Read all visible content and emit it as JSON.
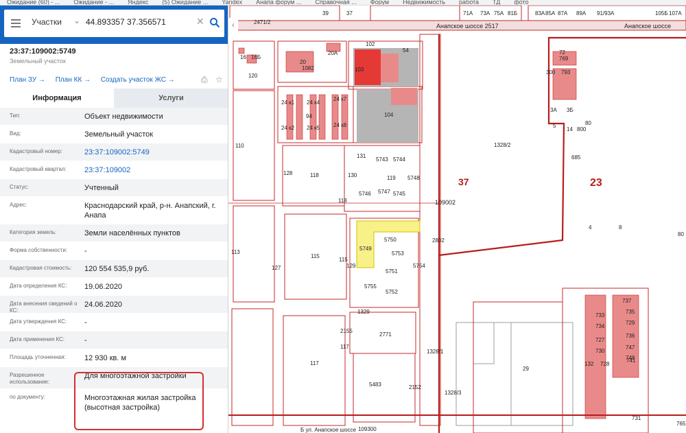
{
  "bookmarks": [
    "Ожидание (60) - ...",
    "Ожидание - ...",
    "Яндекс",
    "(5) Ожидание ...",
    "Yandex",
    "Анапа форум ...",
    "Справочная ...",
    "Форум",
    "Недвижимость",
    "работа",
    "ТД",
    "фото"
  ],
  "search": {
    "mode": "Участки",
    "query": "44.893357 37.356571"
  },
  "parcel": {
    "number": "23:37:109002:5749",
    "type": "Земельный участок"
  },
  "links": [
    "План ЗУ →",
    "План КК →",
    "Создать участок ЖС →"
  ],
  "tabs": [
    "Информация",
    "Услуги"
  ],
  "info": [
    {
      "key": "Тип:",
      "value": "Объект недвижимости"
    },
    {
      "key": "Вид:",
      "value": "Земельный участок"
    },
    {
      "key": "Кадастровый номер:",
      "value": "23:37:109002:5749"
    },
    {
      "key": "Кадастровый квартал:",
      "value": "23:37:109002"
    },
    {
      "key": "Статус:",
      "value": "Учтенный"
    },
    {
      "key": "Адрес:",
      "value": "Краснодарский край, р-н. Анапский, г. Анапа"
    },
    {
      "key": "Категория земель:",
      "value": "Земли населённых пунктов"
    },
    {
      "key": "Форма собственности:",
      "value": "-"
    },
    {
      "key": "Кадастровая стоимость:",
      "value": "120 554 535,9 руб."
    },
    {
      "key": "Дата определения КС:",
      "value": "19.06.2020"
    },
    {
      "key": "Дата внесения сведений о КС:",
      "value": "24.06.2020"
    },
    {
      "key": "Дата утверждения КС:",
      "value": "-"
    },
    {
      "key": "Дата применения КС:",
      "value": "-"
    },
    {
      "key": "Площадь уточненная:",
      "value": "12 930 кв. м"
    },
    {
      "key": "Разрешенное использование:",
      "value": "Для многоэтажной застройки"
    },
    {
      "key": "по документу:",
      "value": "Многоэтажная жилая застройка (высотная застройка)"
    }
  ],
  "map": {
    "road_label_1": "Анапское шоссе 2517",
    "road_label_2": "Анапское шоссе",
    "district_37": "37",
    "district_23": "23",
    "quarter": "109002",
    "labels": [
      "2471/2",
      "39",
      "37",
      "71А",
      "73А",
      "75А",
      "81Б",
      "83А",
      "85А",
      "87А",
      "89А",
      "91/93А",
      "105Б",
      "107А",
      "16",
      "16Б",
      "102",
      "54",
      "20",
      "1082",
      "20А",
      "103",
      "72",
      "769",
      "300",
      "793",
      "120",
      "24 к1",
      "24 к4",
      "24 к7",
      "24 к2",
      "24 к5",
      "24 к8",
      "94",
      "104",
      "3А",
      "3Б",
      "5",
      "14",
      "800",
      "80",
      "110",
      "128",
      "131",
      "5743",
      "5744",
      "1328/2",
      "685",
      "118",
      "130",
      "119",
      "5748",
      "5747",
      "5746",
      "5745",
      "118",
      "4",
      "8",
      "80",
      "5750",
      "5749",
      "2802",
      "113",
      "115",
      "127",
      "115",
      "129",
      "5753",
      "5751",
      "5755",
      "5752",
      "5754",
      "1329",
      "737",
      "735",
      "733",
      "729",
      "734",
      "736",
      "727",
      "747",
      "730",
      "748",
      "741",
      "132",
      "728",
      "29",
      "117",
      "2155",
      "117",
      "2771",
      "1328/1",
      "5483",
      "2152",
      "1328/3",
      "731",
      "765",
      "109300",
      "Б ул. Анапское шоссе"
    ]
  },
  "colors": {
    "accent": "#1565c0",
    "parcel_border": "#d32f2f",
    "selected_parcel": "#f8f18a"
  }
}
